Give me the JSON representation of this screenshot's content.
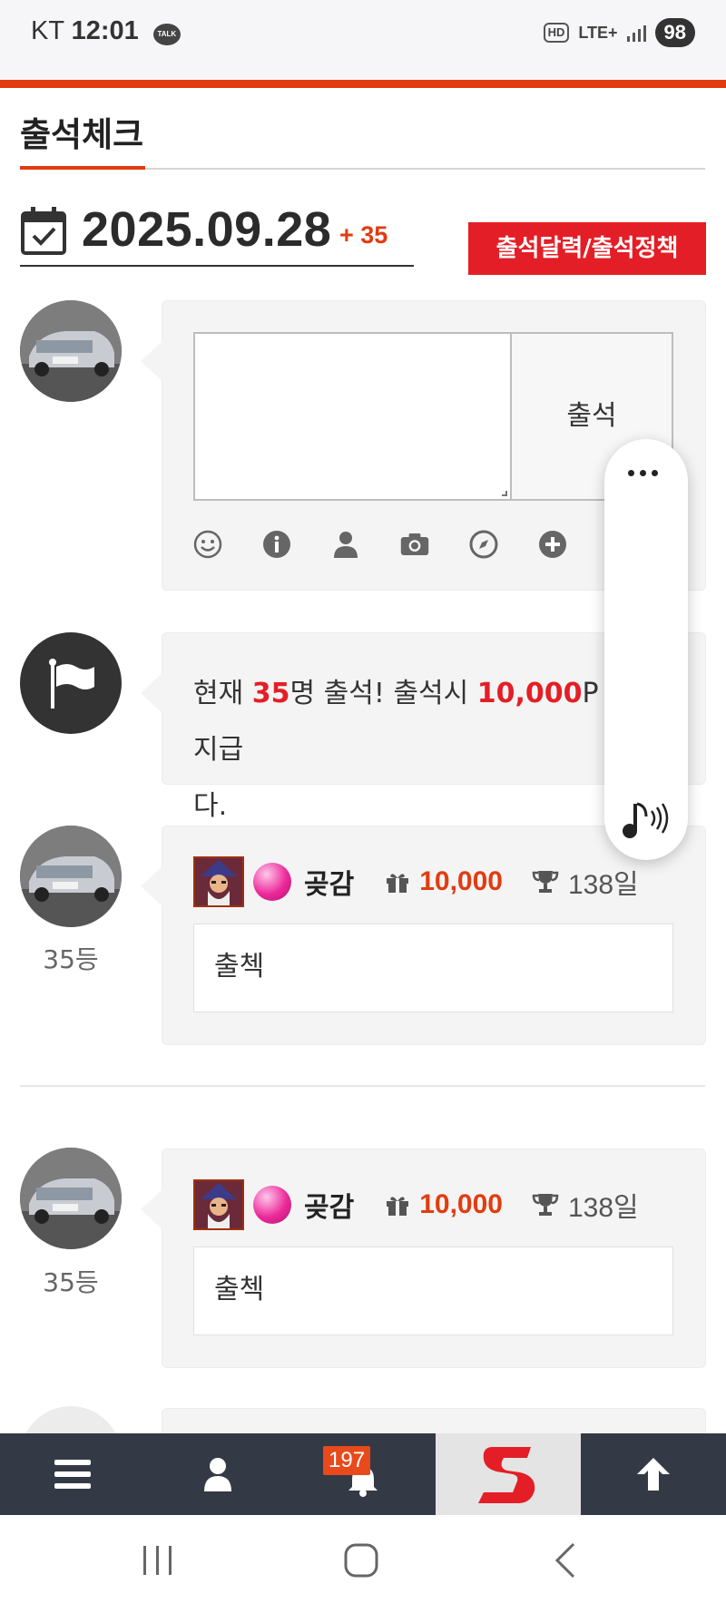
{
  "status_bar": {
    "carrier": "KT",
    "time": "12:01",
    "talk_badge": "TALK",
    "hd_label": "HD",
    "network": "LTE+",
    "battery": "98"
  },
  "page": {
    "title": "출석체크",
    "date": "2025.09.28",
    "date_delta": "+ 35",
    "policy_button": "출석달력/출석정책"
  },
  "composer": {
    "attend_button": "출석",
    "toolbar_icons": [
      "smile-icon",
      "info-icon",
      "user-icon",
      "camera-icon",
      "compass-icon",
      "plus-icon"
    ]
  },
  "notice": {
    "prefix": "현재 ",
    "count": "35",
    "middle": "명 출석! 출석시 ",
    "points": "10,000",
    "suffix_visible": "P 지급",
    "line2": "다."
  },
  "entries": [
    {
      "rank": "35등",
      "nickname": "곶감",
      "points": "10,000",
      "days": "138일",
      "message": "출첵"
    },
    {
      "rank": "35등",
      "nickname": "곶감",
      "points": "10,000",
      "days": "138일",
      "message": "출첵"
    }
  ],
  "bottom_bar": {
    "notification_count": "197"
  },
  "colors": {
    "accent": "#e13c10",
    "button_red": "#e41e26",
    "bottom_bar": "#333a45"
  }
}
